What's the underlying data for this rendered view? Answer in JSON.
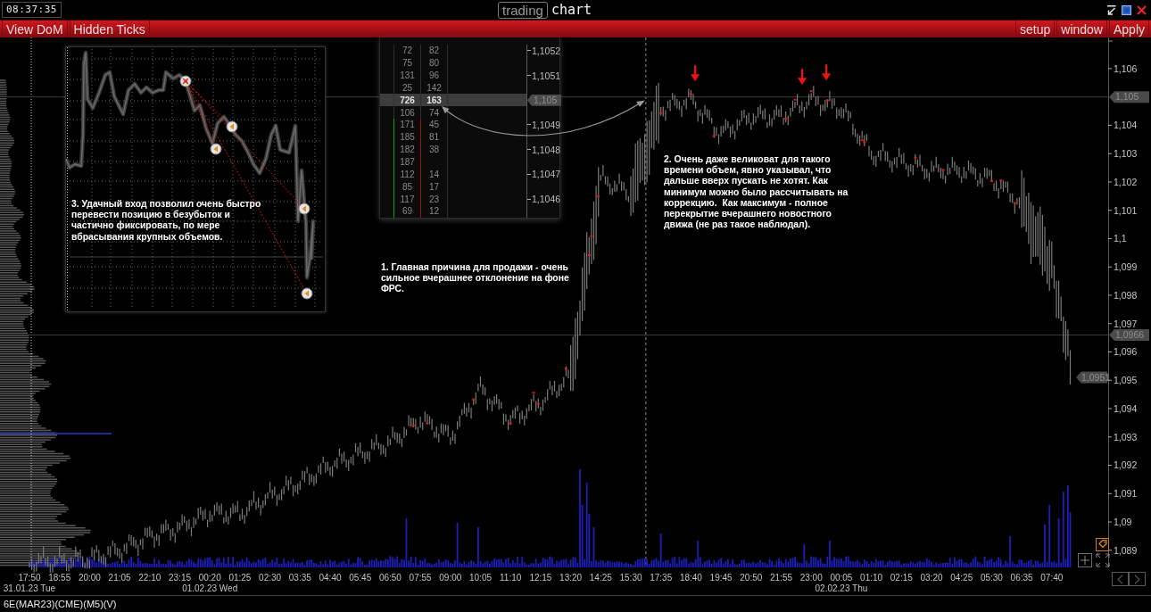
{
  "title_bar": {
    "clock": "08:37:35",
    "logo": {
      "boxed": "trading",
      "plain": "chart"
    }
  },
  "toolbar": {
    "left": [
      {
        "label": "View DoM"
      },
      {
        "label": "Hidden Ticks"
      }
    ],
    "right": [
      {
        "label": "setup"
      },
      {
        "label": "window"
      },
      {
        "label": "Apply"
      }
    ]
  },
  "chart": {
    "price_axis": [
      "1,106",
      "1,104",
      "1,103",
      "1,102",
      "1,101",
      "1,1",
      "1,099",
      "1,098",
      "1,097",
      "1,096",
      "1,095",
      "1,094",
      "1,093",
      "1,092",
      "1,091",
      "1,09",
      "1,089"
    ],
    "time_axis": [
      "17:50",
      "18:55",
      "20:00",
      "21:05",
      "22:10",
      "23:15",
      "00:20",
      "01:25",
      "02:30",
      "03:35",
      "04:40",
      "05:45",
      "06:50",
      "07:55",
      "09:00",
      "10:05",
      "11:10",
      "12:15",
      "13:20",
      "14:25",
      "15:30",
      "17:35",
      "18:40",
      "19:45",
      "20:50",
      "21:55",
      "23:00",
      "00:05",
      "01:10",
      "02:15",
      "03:20",
      "04:25",
      "05:30",
      "06:35",
      "07:40"
    ],
    "dates": [
      "31.01.23 Tue",
      "01.02.23 Wed",
      "02.02.23 Thu"
    ],
    "price_tags": [
      {
        "text": "1,105",
        "kind": "level"
      },
      {
        "text": "1,0966",
        "kind": "level"
      },
      {
        "text": "1,0951",
        "kind": "last"
      }
    ],
    "notes": [
      "1. Главная причина для продажи - очень сильное вчерашнее отклонение на фоне ФРС.",
      "2. Очень даже великоват для такого времени объем, явно указывал, что дальше вверх пускать не хотят. Как минимум можно было рассчитывать на коррекцию.  Как максимум - полное перекрытие вчерашнего новостного движа (не раз такое наблюдал)."
    ],
    "dom_inset": {
      "rows": [
        {
          "bid": "72",
          "ask": "82",
          "price": "1,1052",
          "selected": false
        },
        {
          "bid": "75",
          "ask": "80",
          "selected": false
        },
        {
          "bid": "131",
          "ask": "96",
          "price": "1,1051",
          "selected": false
        },
        {
          "bid": "25",
          "ask": "142",
          "selected": false
        },
        {
          "bid": "726",
          "ask": "163",
          "price": "1,105",
          "selected": true
        },
        {
          "bid": "106",
          "ask": "74",
          "selected": false
        },
        {
          "bid": "171",
          "ask": "45",
          "price": "1,1049",
          "selected": false
        },
        {
          "bid": "185",
          "ask": "81",
          "selected": false
        },
        {
          "bid": "182",
          "ask": "38",
          "price": "1,1048",
          "selected": false
        },
        {
          "bid": "187",
          "selected": false
        },
        {
          "bid": "112",
          "ask": "14",
          "price": "1,1047",
          "selected": false
        },
        {
          "bid": "85",
          "ask": "17",
          "selected": false
        },
        {
          "bid": "117",
          "ask": "23",
          "price": "1,1046",
          "selected": false
        },
        {
          "bid": "69",
          "ask": "12",
          "selected": false
        }
      ]
    },
    "trade_inset": {
      "note": "3. Удачный вход позволил очень быстро перевести позицию в безубыток и частично фиксировать, по мере вбрасывания крупных объемов."
    }
  },
  "status_bar": {
    "instrument": "6E(MAR23)(CME)(M5)(V)"
  }
}
